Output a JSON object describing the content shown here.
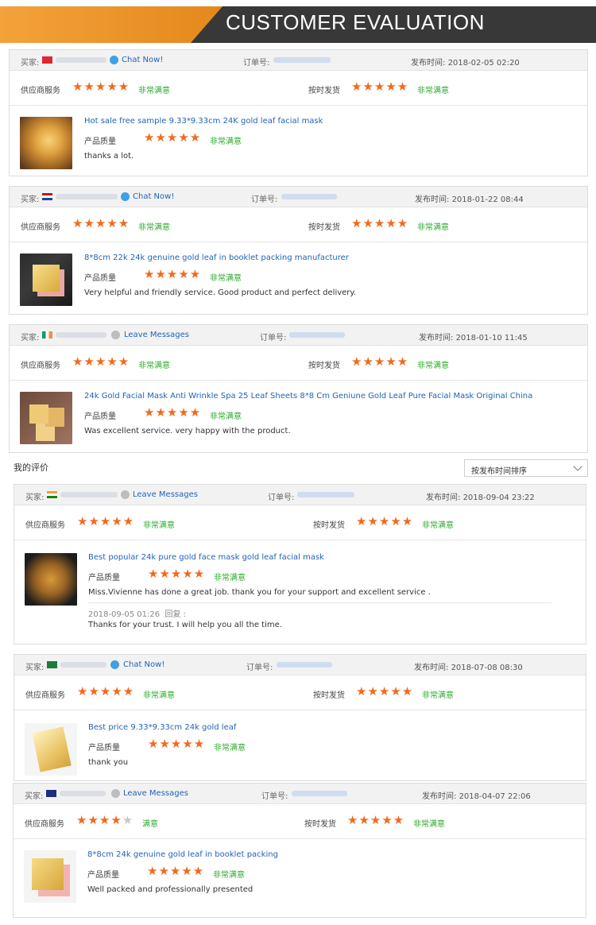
{
  "banner": {
    "title": "CUSTOMER EVALUATION"
  },
  "labels": {
    "buyer": "买家:",
    "order": "订单号:",
    "published": "发布时间:",
    "supplier_service": "供应商服务",
    "on_time": "按时发货",
    "product_quality": "产品质量",
    "reply": "回复 :"
  },
  "my_reviews": {
    "title": "我的评价",
    "sort_selected": "按发布时间排序"
  },
  "reviews": [
    {
      "action": "Chat Now!",
      "date": "2018-02-05 02:20",
      "service_stars": 5,
      "service_sat": "非常满意",
      "ship_stars": 5,
      "ship_sat": "非常满意",
      "product": "Hot sale free sample 9.33*9.33cm 24K gold leaf facial mask",
      "quality_stars": 5,
      "quality_sat": "非常满意",
      "comment": "thanks a lot."
    },
    {
      "action": "Chat Now!",
      "date": "2018-01-22 08:44",
      "service_stars": 5,
      "service_sat": "非常满意",
      "ship_stars": 5,
      "ship_sat": "非常满意",
      "product": "8*8cm 22k 24k genuine gold leaf in booklet packing manufacturer",
      "quality_stars": 5,
      "quality_sat": "非常满意",
      "comment": "Very helpful and friendly service. Good product and perfect delivery."
    },
    {
      "action": "Leave Messages",
      "date": "2018-01-10 11:45",
      "service_stars": 5,
      "service_sat": "非常满意",
      "ship_stars": 5,
      "ship_sat": "非常满意",
      "product": "24k Gold Facial Mask Anti Wrinkle Spa 25 Leaf Sheets 8*8 Cm Geniune Gold Leaf Pure Facial Mask Original China",
      "quality_stars": 5,
      "quality_sat": "非常满意",
      "comment": "Was excellent service. very happy with the product."
    },
    {
      "action": "Leave Messages",
      "date": "2018-09-04 23:22",
      "service_stars": 5,
      "service_sat": "非常满意",
      "ship_stars": 5,
      "ship_sat": "非常满意",
      "product": "Best popular 24k pure gold face mask gold leaf facial mask",
      "quality_stars": 5,
      "quality_sat": "非常满意",
      "comment": "Miss.Vivienne has done a great job. thank you for your support and excellent service .",
      "reply_time": "2018-09-05 01:26",
      "reply_text": "Thanks for your trust. I will help you all the time."
    },
    {
      "action": "Chat Now!",
      "date": "2018-07-08 08:30",
      "service_stars": 5,
      "service_sat": "非常满意",
      "ship_stars": 5,
      "ship_sat": "非常满意",
      "product": "Best price 9.33*9.33cm 24k gold leaf",
      "quality_stars": 5,
      "quality_sat": "非常满意",
      "comment": "thank you"
    },
    {
      "action": "Leave Messages",
      "date": "2018-04-07 22:06",
      "service_stars": 4,
      "service_sat": "满意",
      "ship_stars": 5,
      "ship_sat": "非常满意",
      "product": "8*8cm 24k genuine gold leaf in booklet packing",
      "quality_stars": 5,
      "quality_sat": "非常满意",
      "comment": "Well packed and professionally presented"
    }
  ],
  "colors": {
    "star": "#f26a1b",
    "satisfied": "#2ba82b",
    "link": "#1f63b8",
    "banner_gold": "#f3a23a",
    "banner_dark": "#383838"
  }
}
